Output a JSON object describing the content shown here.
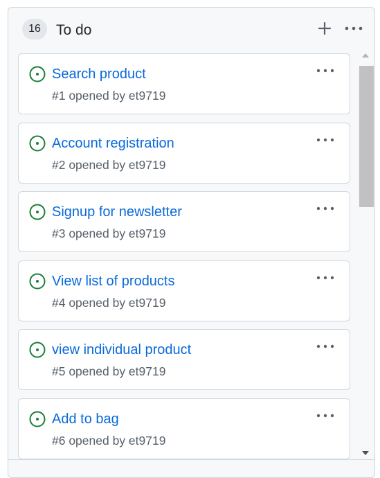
{
  "column": {
    "count": "16",
    "title": "To do",
    "add_icon": "plus-icon",
    "menu_icon": "kebab-horizontal-icon"
  },
  "cards": [
    {
      "title": "Search product",
      "meta": "#1 opened by et9719"
    },
    {
      "title": "Account registration",
      "meta": "#2 opened by et9719"
    },
    {
      "title": "Signup for newsletter",
      "meta": "#3 opened by et9719"
    },
    {
      "title": "View list of products",
      "meta": "#4 opened by et9719"
    },
    {
      "title": "view individual product",
      "meta": "#5 opened by et9719"
    },
    {
      "title": "Add to bag",
      "meta": "#6 opened by et9719"
    }
  ],
  "colors": {
    "issue_open": "#1a7f37",
    "link": "#0969da",
    "muted": "#57606a"
  }
}
